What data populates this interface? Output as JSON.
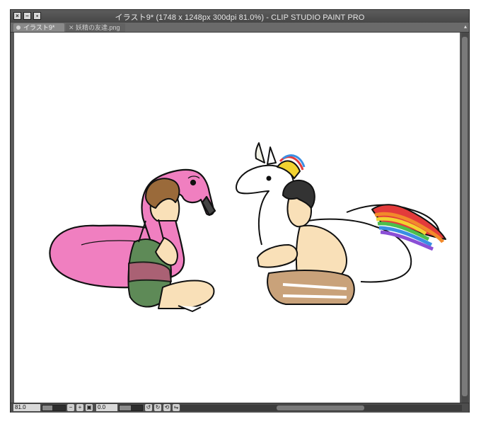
{
  "window": {
    "title": "イラスト9* (1748 x 1248px 300dpi 81.0%)  - CLIP STUDIO PAINT PRO",
    "close_glyph": "×",
    "minimize_glyph": "–",
    "maximize_glyph": "▪"
  },
  "tabs": [
    {
      "label": "イラスト9*",
      "active": true
    },
    {
      "label": "妖精の友達.png",
      "active": false
    }
  ],
  "statusbar": {
    "zoom": "81.0",
    "zoom_level": 0.45,
    "rotation": "0.0",
    "rotation_level": 0.5,
    "icons": [
      "zoom-out-icon",
      "zoom-in-icon",
      "fit-icon",
      "rotate-left-icon",
      "rotate-right-icon",
      "reset-rotation-icon",
      "flip-icon"
    ]
  },
  "canvas": {
    "background": "#ffffff",
    "colors": {
      "flamingo": "#f07fc0",
      "skin": "#f9e0b8",
      "hair": "#9a6a3a",
      "swimsuit": "#5e8a57",
      "shorts": "#c9a27a",
      "rainbow": [
        "#e33b3b",
        "#f28a2b",
        "#f2d230",
        "#4cbf4c",
        "#3b8fe3",
        "#8b4fd6"
      ]
    }
  }
}
